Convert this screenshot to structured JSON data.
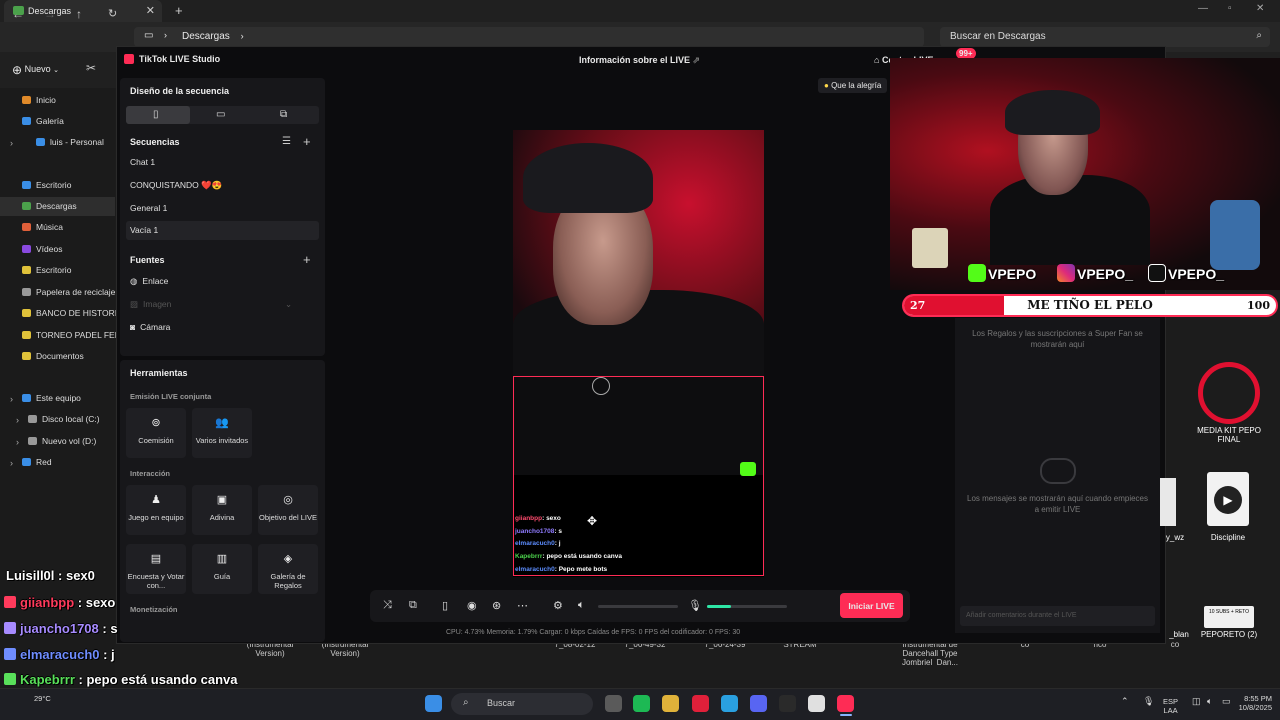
{
  "explorer": {
    "tab_title": "Descargas",
    "tab_close": "✕",
    "new_tab": "+",
    "breadcrumb": "Descargas",
    "search_placeholder": "Buscar en Descargas",
    "new_button": "Nuevo",
    "sidebar": [
      {
        "label": "Inicio",
        "color": "#e08a2a"
      },
      {
        "label": "Galería",
        "color": "#3a8ee6"
      },
      {
        "label": "luis - Personal",
        "color": "#3a8ee6"
      },
      {
        "label": "Escritorio",
        "color": "#3a8ee6"
      },
      {
        "label": "Descargas",
        "color": "#4ba14b"
      },
      {
        "label": "Música",
        "color": "#e0603a"
      },
      {
        "label": "Vídeos",
        "color": "#8a4ae0"
      },
      {
        "label": "Escritorio",
        "color": "#e0c23a"
      },
      {
        "label": "Papelera de reciclaje",
        "color": "#999"
      },
      {
        "label": "BANCO DE HISTORIAS",
        "color": "#e0c23a"
      },
      {
        "label": "TORNEO PADEL FEME",
        "color": "#e0c23a"
      },
      {
        "label": "Documentos",
        "color": "#e0c23a"
      },
      {
        "label": "Este equipo",
        "color": "#3a8ee6"
      },
      {
        "label": "Disco local (C:)",
        "color": "#999"
      },
      {
        "label": "Nuevo vol (D:)",
        "color": "#999"
      },
      {
        "label": "Red",
        "color": "#3a8ee6"
      }
    ],
    "file_labels": [
      "(Instrumental\nVersion)",
      "(Instrumental\nVersion)",
      "7_08-02-12",
      "7_06-49-32",
      "7_06-24-39",
      "STREAM",
      "Instrumental de\nDancehall Type\nJombriel  Dan...",
      "co",
      "nco",
      "co"
    ]
  },
  "tiktok": {
    "app_title": "TikTok LIVE Studio",
    "center_title": "Información sobre el LIVE",
    "centro_label": "Centro LIVE",
    "badge": "99+",
    "layout_title": "Diseño de la secuencia",
    "sequences_title": "Secuencias",
    "sequences": [
      "Chat 1",
      "CONQUISTANDO ❤️😍",
      "General 1",
      "Vacía 1"
    ],
    "sources_title": "Fuentes",
    "sources": [
      "Enlace",
      "Imagen",
      "Cámara"
    ],
    "tools_title": "Herramientas",
    "cohost_title": "Emisión LIVE conjunta",
    "cohost_tools": [
      {
        "label": "Coemisión",
        "icon": "⊚"
      },
      {
        "label": "Varios invitados",
        "icon": "👥"
      }
    ],
    "interaction_title": "Interacción",
    "interaction_tools": [
      {
        "label": "Juego en equipo",
        "icon": "♟"
      },
      {
        "label": "Adivina",
        "icon": "▣"
      },
      {
        "label": "Objetivo del LIVE",
        "icon": "◎"
      },
      {
        "label": "Encuesta y Votar con...",
        "icon": "▤"
      },
      {
        "label": "Guía",
        "icon": "▥"
      },
      {
        "label": "Galería de Regalos",
        "icon": "◈"
      }
    ],
    "monetization_title": "Monetización",
    "hint": "Que la alegría",
    "go_live": "Iniciar LIVE",
    "stats": "CPU: 4.73%    Memoria: 1.79%    Cargar: 0 kbps    Caídas de FPS: 0    FPS del codificador: 0    FPS: 30",
    "gifts_empty": "Los Regalos y las suscripciones a Super Fan se mostrarán aquí",
    "messages_empty": "Los mensajes se mostrarán aquí cuando empieces a emitir LIVE",
    "comment_placeholder": "Añadir comentarios durante el LIVE",
    "volume_level": 0.3,
    "preview_chat": [
      {
        "user": "giianbpp",
        "text": ": sexo",
        "color": "#ff4b6e"
      },
      {
        "user": "juancho1708",
        "text": ": s",
        "color": "#8f7bff"
      },
      {
        "user": "elmaracuch0",
        "text": ": j",
        "color": "#5c8dff"
      },
      {
        "user": "Kapebrrr",
        "text": ": pepo está usando canva",
        "color": "#4bd14b"
      },
      {
        "user": "elmaracuch0",
        "text": ": Pepo mete bots",
        "color": "#5c8dff"
      }
    ]
  },
  "overlay": {
    "socials": [
      "VPEPO",
      "VPEPO_",
      "VPEPO_"
    ],
    "goal_title": "ME TIÑO EL PELO",
    "goal_current": "27",
    "goal_target": "100",
    "goal_progress": 0.27,
    "desktop_icons": [
      {
        "label": "MEDIA KIT PEPO\nFINAL"
      },
      {
        "label": "Discipline"
      },
      {
        "label": "PEPORETO (2)"
      },
      {
        "label": "_blan"
      },
      {
        "label": "y_wz"
      }
    ],
    "stream_chat": [
      {
        "user": "Luisill0l",
        "text": " : sex0",
        "color": "#ffffff"
      },
      {
        "user": "giianbpp",
        "text": " : sexo",
        "color": "#ff3b5c"
      },
      {
        "user": "juancho1708",
        "text": " : s",
        "color": "#a78bff"
      },
      {
        "user": "elmaracuch0",
        "text": " : j",
        "color": "#6f8dff"
      },
      {
        "user": "Kapebrrr",
        "text": " : pepo está usando canva",
        "color": "#59e05a"
      },
      {
        "user": "elmaracuch0",
        "text": " : Pepo mete bots",
        "color": "#6f8dff"
      }
    ]
  },
  "taskbar": {
    "search": "Buscar",
    "weather": "29°C",
    "lang": "ESP\nLAA",
    "time": "8:55 PM",
    "date": "10/8/2025",
    "apps": [
      {
        "name": "start-icon",
        "color": "#3a8ee6"
      },
      {
        "name": "task-view-icon",
        "color": "#5a5a5a"
      },
      {
        "name": "spotify-icon",
        "color": "#1db954"
      },
      {
        "name": "file-explorer-icon",
        "color": "#e0b23a"
      },
      {
        "name": "opera-icon",
        "color": "#e0203a"
      },
      {
        "name": "telegram-icon",
        "color": "#2aa0e0"
      },
      {
        "name": "discord-icon",
        "color": "#5865f2"
      },
      {
        "name": "capcut-icon",
        "color": "#2a2a2a"
      },
      {
        "name": "chrome-icon",
        "color": "#e0e0e0"
      },
      {
        "name": "tiktok-icon",
        "color": "#fe2c55"
      }
    ]
  }
}
